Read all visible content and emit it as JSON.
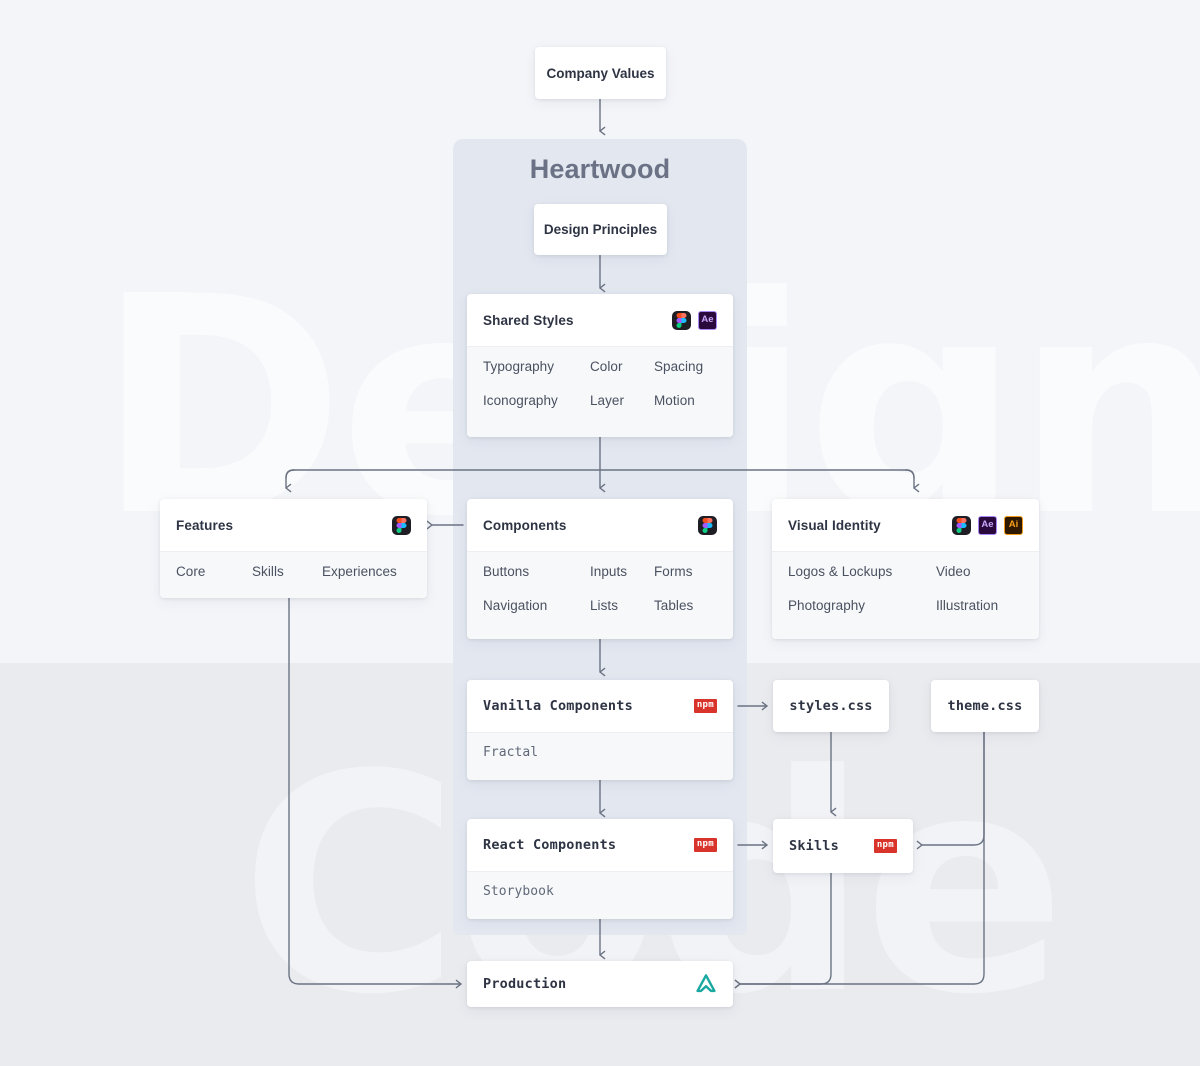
{
  "background": {
    "watermark_top": "Design",
    "watermark_bottom": "Code",
    "top_band_color": "#f4f5f9",
    "bottom_band_color": "#eaebef"
  },
  "panel": {
    "title": "Heartwood",
    "color": "#e3e7f0"
  },
  "nodes": {
    "company_values": {
      "title": "Company Values"
    },
    "design_principles": {
      "title": "Design Principles"
    },
    "shared_styles": {
      "title": "Shared Styles",
      "icons": [
        "figma-icon",
        "after-effects-icon"
      ],
      "items": [
        "Typography",
        "Color",
        "Spacing",
        "Iconography",
        "Layer",
        "Motion"
      ]
    },
    "features": {
      "title": "Features",
      "icons": [
        "figma-icon"
      ],
      "items": [
        "Core",
        "Skills",
        "Experiences"
      ]
    },
    "components": {
      "title": "Components",
      "icons": [
        "figma-icon"
      ],
      "items": [
        "Buttons",
        "Inputs",
        "Forms",
        "Navigation",
        "Lists",
        "Tables"
      ]
    },
    "visual_identity": {
      "title": "Visual Identity",
      "icons": [
        "figma-icon",
        "after-effects-icon",
        "illustrator-icon"
      ],
      "items": [
        "Logos & Lockups",
        "Video",
        "Photography",
        "Illustration"
      ]
    },
    "vanilla_components": {
      "title": "Vanilla Components",
      "badge": "npm",
      "items": [
        "Fractal"
      ]
    },
    "react_components": {
      "title": "React Components",
      "badge": "npm",
      "items": [
        "Storybook"
      ]
    },
    "styles_css": {
      "title": "styles.css"
    },
    "theme_css": {
      "title": "theme.css"
    },
    "skills": {
      "title": "Skills",
      "badge": "npm"
    },
    "production": {
      "title": "Production",
      "icon": "aurora-logo-icon",
      "icon_color": "#18a8a0"
    }
  },
  "colors": {
    "card_bg": "#ffffff",
    "card_body_bg": "#f7f8fa",
    "title_text": "#2e3444",
    "item_text": "#4a5160",
    "connector": "#6b7383",
    "npm_red": "#d9342b",
    "figma_bg": "#1e1e24",
    "ae_accent": "#c9a7fb",
    "ai_accent": "#f8a01c"
  }
}
